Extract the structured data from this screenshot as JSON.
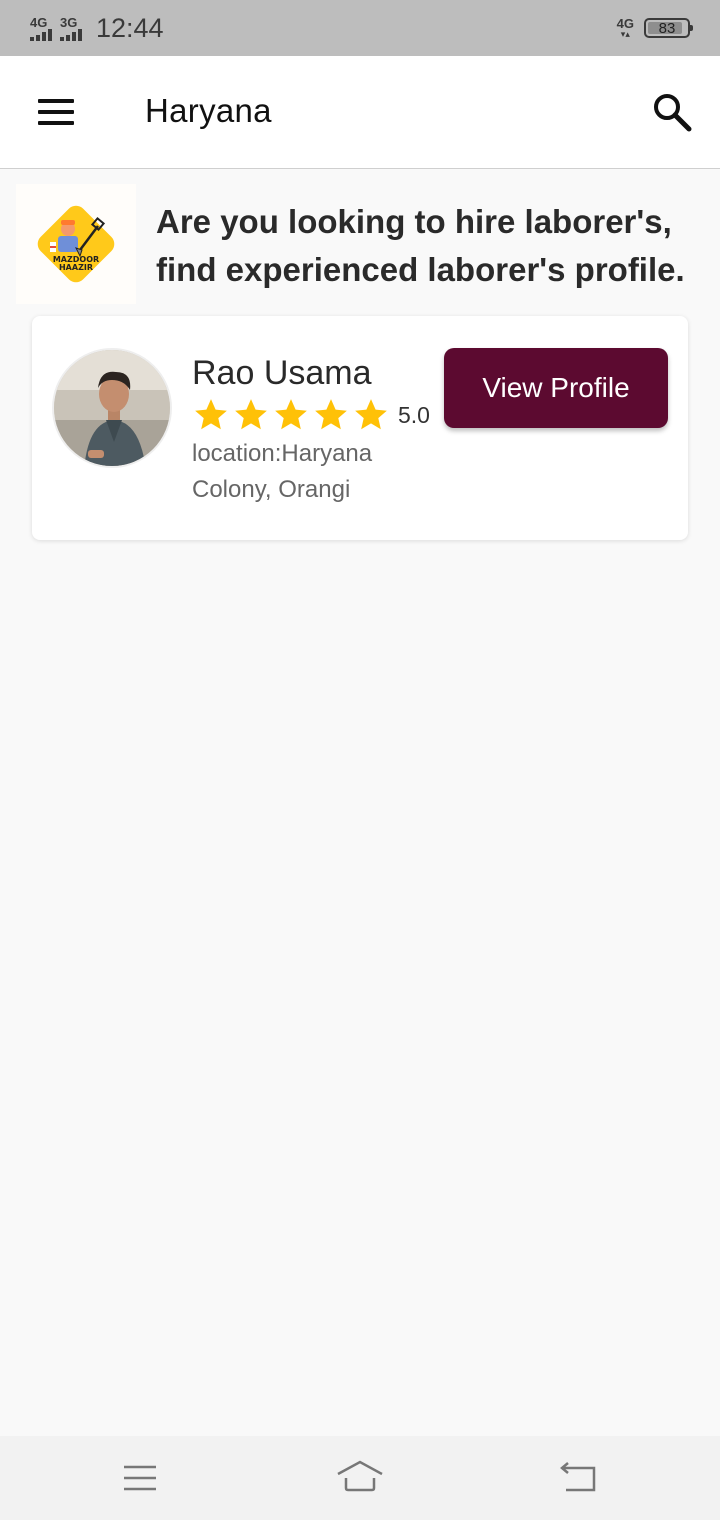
{
  "status_bar": {
    "net1": "4G",
    "net2": "3G",
    "time": "12:44",
    "net_right": "4G",
    "battery": "83"
  },
  "app_bar": {
    "title": "Haryana",
    "menu_icon": "hamburger-menu-icon",
    "search_icon": "search-icon"
  },
  "banner": {
    "logo_text_line1": "MAZDOOR",
    "logo_text_line2": "HAAZIR",
    "text": "Are you looking to hire laborer's, find experienced laborer's profile."
  },
  "workers": [
    {
      "name": "Rao Usama",
      "rating": 5,
      "rating_text": "5.0",
      "location": "location:Haryana Colony, Orangi",
      "button_label": "View Profile"
    }
  ],
  "colors": {
    "accent": "#5c0a30",
    "star": "#ffc107",
    "logo_yellow": "#ffc91a"
  },
  "nav_bar": {
    "icons": [
      "menu-lines-icon",
      "home-icon",
      "back-icon"
    ]
  }
}
